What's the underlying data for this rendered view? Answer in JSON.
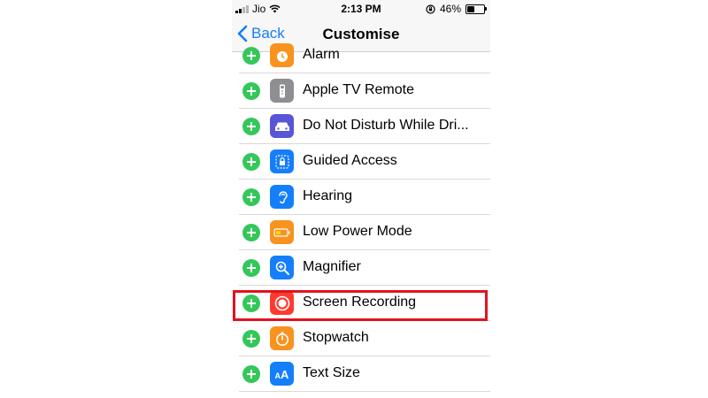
{
  "status_bar": {
    "carrier": "Jio",
    "time": "2:13 PM",
    "battery": "46%"
  },
  "nav": {
    "back_label": "Back",
    "title": "Customise"
  },
  "rows": [
    {
      "label": "Alarm",
      "icon": "alarm-icon",
      "icon_color": "#f7931e"
    },
    {
      "label": "Apple TV Remote",
      "icon": "remote-icon",
      "icon_color": "#8e8e93"
    },
    {
      "label": "Do Not Disturb While Dri...",
      "icon": "car-icon",
      "icon_color": "#5856d6"
    },
    {
      "label": "Guided Access",
      "icon": "lock-icon",
      "icon_color": "#147efb"
    },
    {
      "label": "Hearing",
      "icon": "ear-icon",
      "icon_color": "#147efb"
    },
    {
      "label": "Low Power Mode",
      "icon": "battery-icon",
      "icon_color": "#f7931e"
    },
    {
      "label": "Magnifier",
      "icon": "magnifier-icon",
      "icon_color": "#147efb"
    },
    {
      "label": "Screen Recording",
      "icon": "record-icon",
      "icon_color": "#ff3b30"
    },
    {
      "label": "Stopwatch",
      "icon": "stopwatch-icon",
      "icon_color": "#f7931e"
    },
    {
      "label": "Text Size",
      "icon": "text-size-icon",
      "icon_color": "#147efb"
    }
  ],
  "highlight_color": "#e2121e"
}
